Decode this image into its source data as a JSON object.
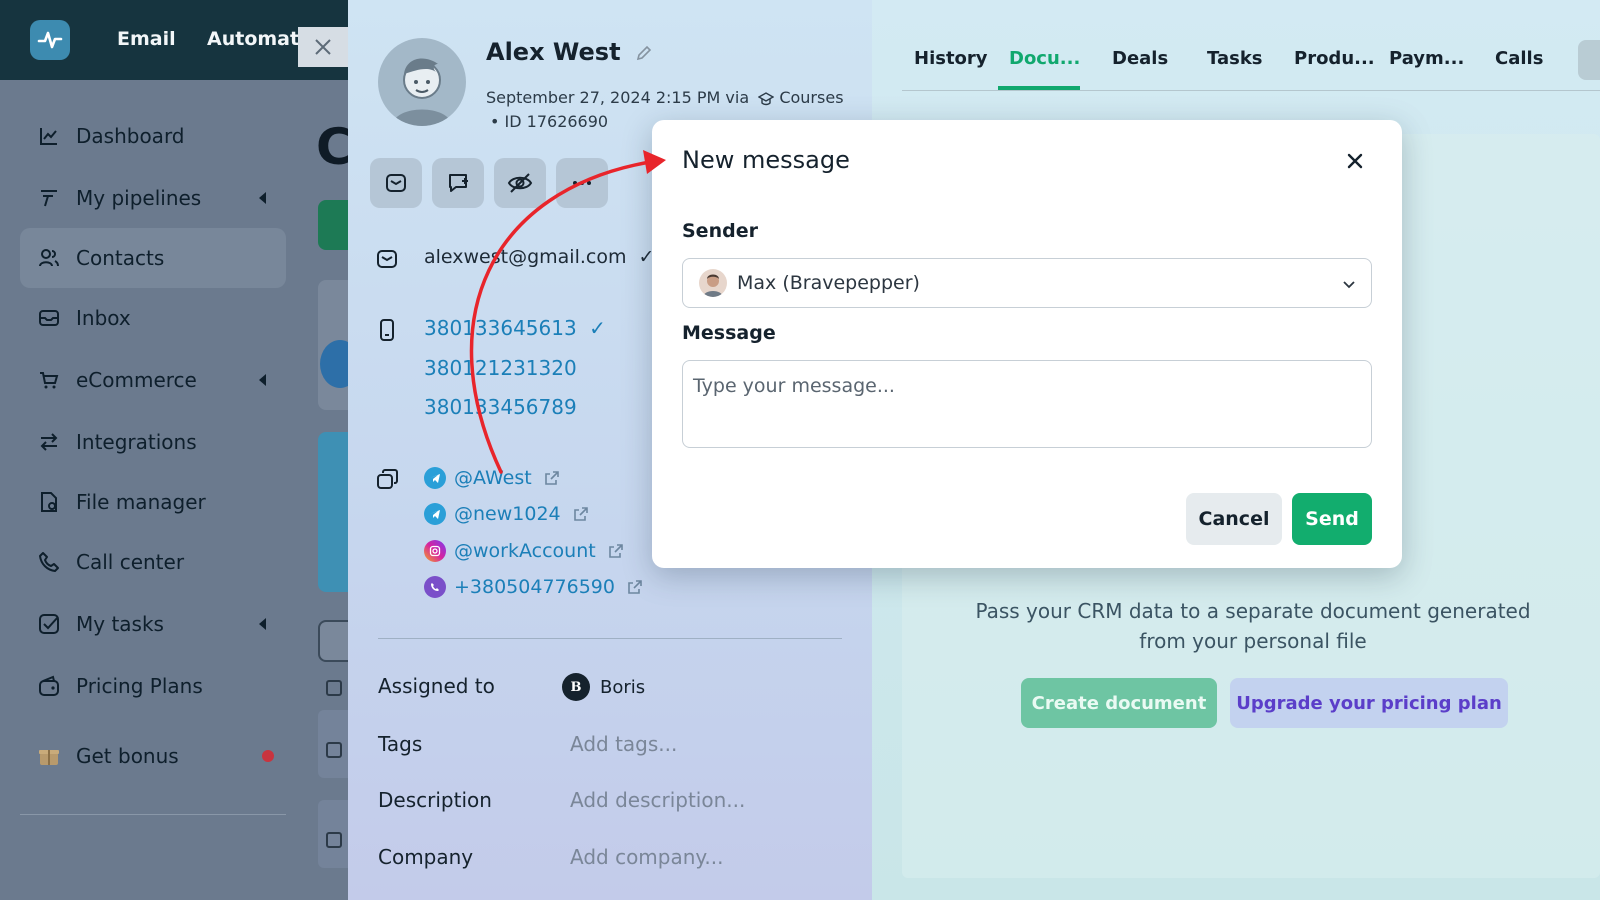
{
  "topbar": {
    "nav": [
      "Email",
      "Automatic"
    ]
  },
  "sidebar": {
    "items": [
      {
        "label": "Dashboard",
        "icon": "chart-line-icon"
      },
      {
        "label": "My pipelines",
        "icon": "funnel-icon"
      },
      {
        "label": "Contacts",
        "icon": "users-icon"
      },
      {
        "label": "Inbox",
        "icon": "inbox-icon"
      },
      {
        "label": "eCommerce",
        "icon": "cart-icon"
      },
      {
        "label": "Integrations",
        "icon": "arrows-icon"
      },
      {
        "label": "File manager",
        "icon": "file-icon"
      },
      {
        "label": "Call center",
        "icon": "phone-icon"
      },
      {
        "label": "My tasks",
        "icon": "check-icon"
      },
      {
        "label": "Pricing Plans",
        "icon": "wallet-icon"
      },
      {
        "label": "Get bonus",
        "icon": "gift-icon"
      }
    ],
    "active": "Contacts"
  },
  "page": {
    "title_initial": "C"
  },
  "contact": {
    "name": "Alex West",
    "created": "September 27, 2024 2:15 PM via",
    "source": "Courses",
    "id": "• ID 17626690",
    "email": "alexwest@gmail.com",
    "phones": [
      "380133645613",
      "380121231320",
      "380133456789"
    ],
    "socials": [
      {
        "handle": "@AWest",
        "network": "telegram"
      },
      {
        "handle": "@new1024",
        "network": "telegram"
      },
      {
        "handle": "@workAccount",
        "network": "instagram"
      },
      {
        "handle": "+380504776590",
        "network": "viber"
      }
    ],
    "fields": {
      "assigned_label": "Assigned to",
      "assigned_value": "Boris",
      "tags_label": "Tags",
      "tags_value": "Add tags...",
      "description_label": "Description",
      "description_value": "Add description...",
      "company_label": "Company",
      "company_value": "Add company..."
    }
  },
  "tabs": {
    "items": [
      "History",
      "Docu...",
      "Deals",
      "Tasks",
      "Produ...",
      "Paym...",
      "Calls"
    ],
    "active": "Docu..."
  },
  "documents": {
    "description": "Pass your CRM data to a separate document generated from your personal file",
    "create_label": "Create document",
    "upgrade_label": "Upgrade your pricing plan"
  },
  "modal": {
    "title": "New message",
    "sender_label": "Sender",
    "sender_value": "Max (Bravepepper)",
    "message_label": "Message",
    "message_placeholder": "Type your message...",
    "cancel_label": "Cancel",
    "send_label": "Send"
  },
  "colors": {
    "accent": "#12ad6e",
    "link": "#1b7fb8",
    "annotation_arrow": "#e8252b"
  }
}
